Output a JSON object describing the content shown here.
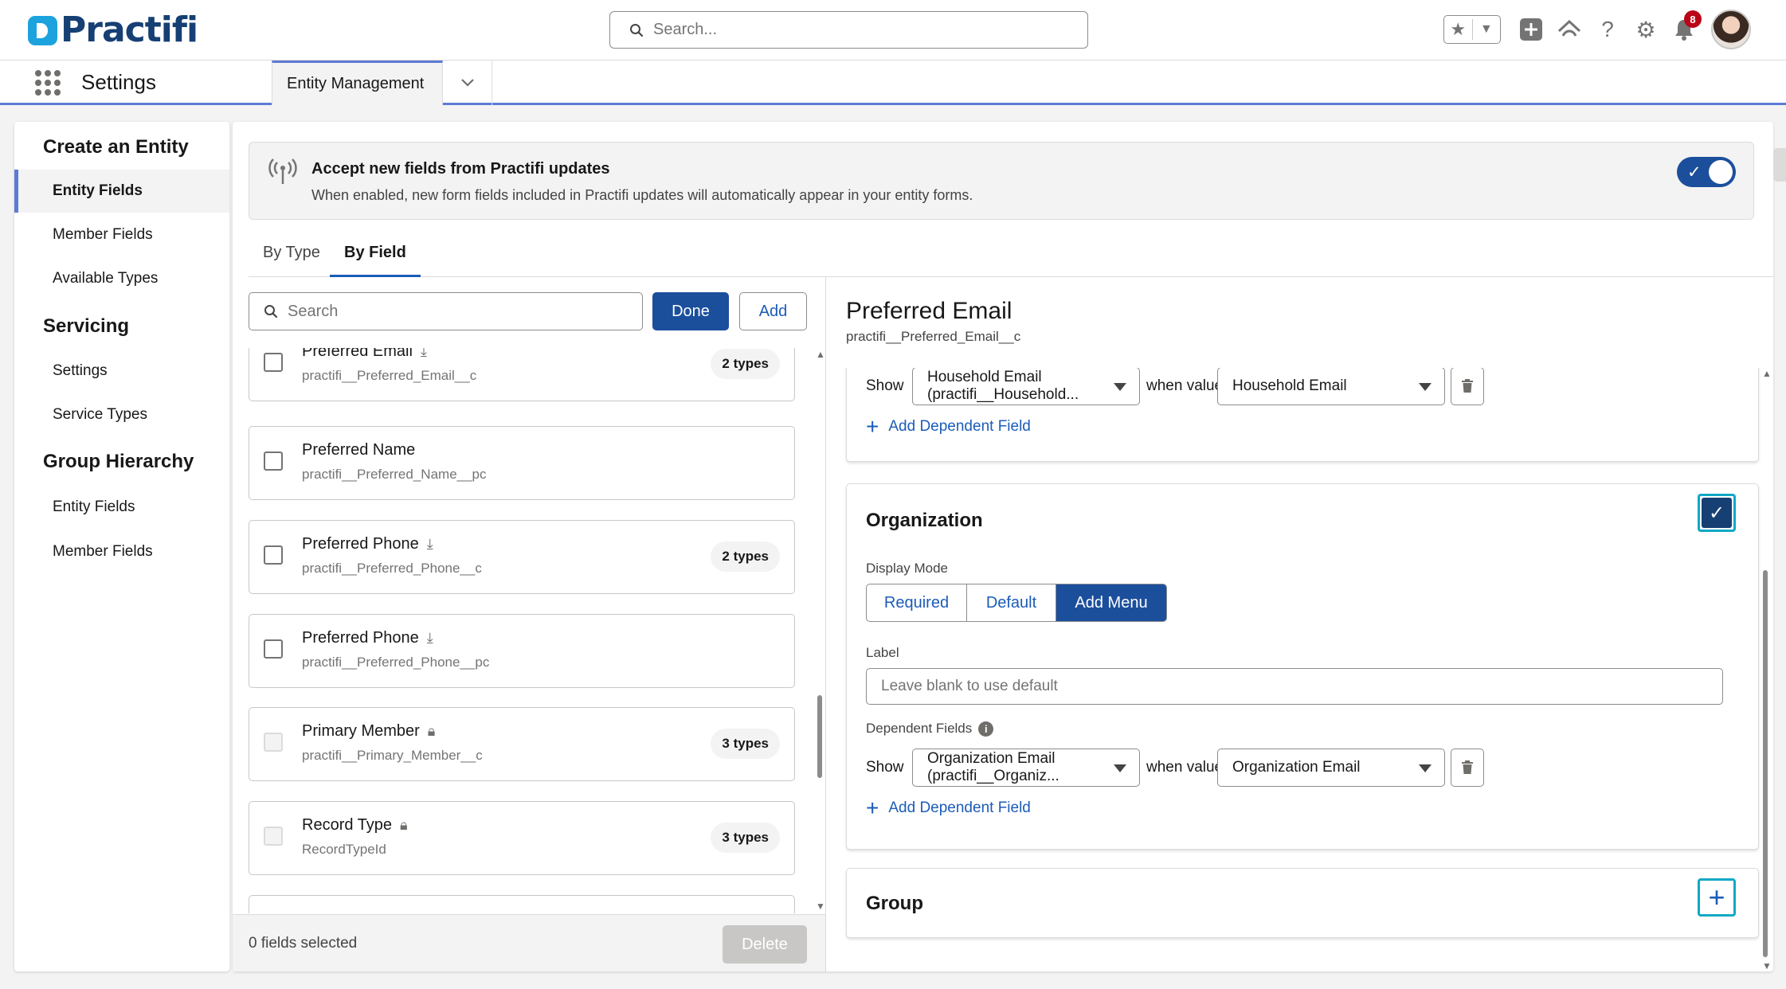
{
  "header": {
    "logo_text": "Practifi",
    "search_placeholder": "Search...",
    "notification_count": "8",
    "icons": [
      "star-icon",
      "chevron-down-icon",
      "add-icon",
      "trailhead-icon",
      "help-icon",
      "gear-icon",
      "bell-icon"
    ]
  },
  "nav": {
    "app_name": "Settings",
    "tab_label": "Entity Management"
  },
  "sidebar": {
    "sections": [
      {
        "heading": "Create an Entity",
        "items": [
          "Entity Fields",
          "Member Fields",
          "Available Types"
        ]
      },
      {
        "heading": "Servicing",
        "items": [
          "Settings",
          "Service Types"
        ]
      },
      {
        "heading": "Group Hierarchy",
        "items": [
          "Entity Fields",
          "Member Fields"
        ]
      }
    ],
    "active_item": "Entity Fields"
  },
  "banner": {
    "title": "Accept new fields from Practifi updates",
    "description": "When enabled, new form fields included in Practifi updates will automatically appear in your entity forms.",
    "toggle_on": true
  },
  "tabs": [
    {
      "label": "By Type",
      "active": false
    },
    {
      "label": "By Field",
      "active": true
    }
  ],
  "field_list": {
    "search_placeholder": "Search",
    "done_label": "Done",
    "add_label": "Add",
    "fields": [
      {
        "name": "Preferred Email",
        "api": "practifi__Preferred_Email__c",
        "icon": "download-icon",
        "badge": "2 types",
        "disabled": false
      },
      {
        "name": "Preferred Name",
        "api": "practifi__Preferred_Name__pc",
        "icon": "",
        "badge": "",
        "disabled": false
      },
      {
        "name": "Preferred Phone",
        "api": "practifi__Preferred_Phone__c",
        "icon": "download-icon",
        "badge": "2 types",
        "disabled": false
      },
      {
        "name": "Preferred Phone",
        "api": "practifi__Preferred_Phone__pc",
        "icon": "download-icon",
        "badge": "",
        "disabled": false
      },
      {
        "name": "Primary Member",
        "api": "practifi__Primary_Member__c",
        "icon": "lock-icon",
        "badge": "3 types",
        "disabled": true
      },
      {
        "name": "Record Type",
        "api": "RecordTypeId",
        "icon": "lock-icon",
        "badge": "3 types",
        "disabled": true
      }
    ],
    "selected_count_text": "0 fields selected",
    "delete_label": "Delete"
  },
  "detail": {
    "title": "Preferred Email",
    "api_name": "practifi__Preferred_Email__c",
    "household_partial": {
      "show_label": "Show",
      "field_select": "Household Email (practifi__Household...",
      "when_label": "when value is",
      "value_select": "Household Email",
      "add_dependent": "Add Dependent Field"
    },
    "organization": {
      "title": "Organization",
      "checked": true,
      "display_mode_label": "Display Mode",
      "display_modes": [
        "Required",
        "Default",
        "Add Menu"
      ],
      "selected_mode": "Add Menu",
      "label_label": "Label",
      "label_placeholder": "Leave blank to use default",
      "dependent_fields_label": "Dependent Fields",
      "show_label": "Show",
      "field_select": "Organization Email (practifi__Organiz...",
      "when_label": "when value is",
      "value_select": "Organization Email",
      "add_dependent": "Add Dependent Field"
    },
    "group": {
      "title": "Group",
      "checked": false
    }
  }
}
